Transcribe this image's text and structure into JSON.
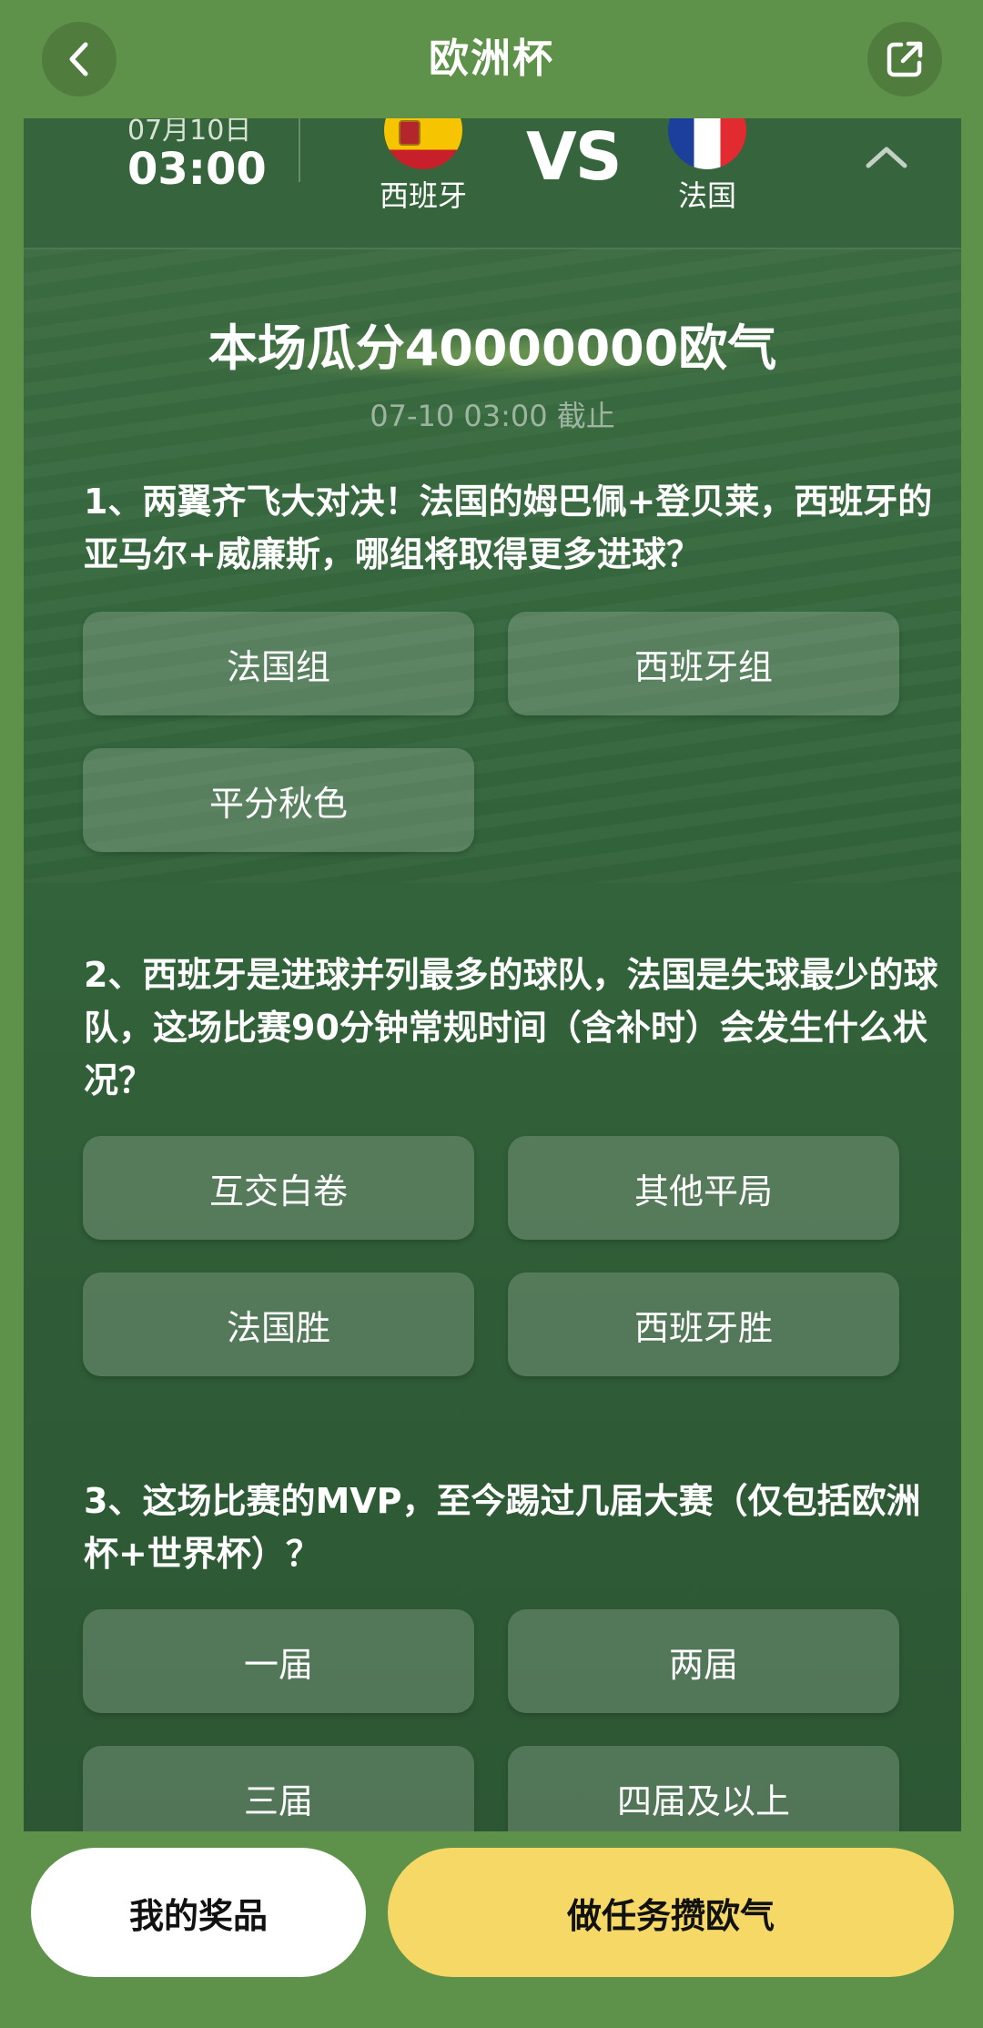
{
  "nav": {
    "title": "欧洲杯",
    "back_icon": "chevron-left-icon",
    "share_icon": "external-link-icon"
  },
  "match": {
    "date": "07月10日",
    "time": "03:00",
    "vs": "VS",
    "home_team": "西班牙",
    "away_team": "法国",
    "collapse_icon": "chevron-up-icon"
  },
  "prize": {
    "title": "本场瓜分40000000欧气",
    "deadline": "07-10 03:00 截止"
  },
  "questions": [
    {
      "text": "1、两翼齐飞大对决！法国的姆巴佩+登贝莱，西班牙的亚马尔+威廉斯，哪组将取得更多进球？",
      "options": [
        "法国组",
        "西班牙组",
        "平分秋色"
      ]
    },
    {
      "text": "2、西班牙是进球并列最多的球队，法国是失球最少的球队，这场比赛90分钟常规时间（含补时）会发生什么状况？",
      "options": [
        "互交白卷",
        "其他平局",
        "法国胜",
        "西班牙胜"
      ]
    },
    {
      "text": "3、这场比赛的MVP，至今踢过几届大赛（仅包括欧洲杯+世界杯）？",
      "options": [
        "一届",
        "两届",
        "三届",
        "四届及以上"
      ]
    }
  ],
  "bottom": {
    "my_prizes": "我的奖品",
    "earn_points": "做任务攒欧气"
  },
  "colors": {
    "page_bg": "#5e9149",
    "card_bg": "#34663c",
    "primary_button": "#f6d867"
  }
}
